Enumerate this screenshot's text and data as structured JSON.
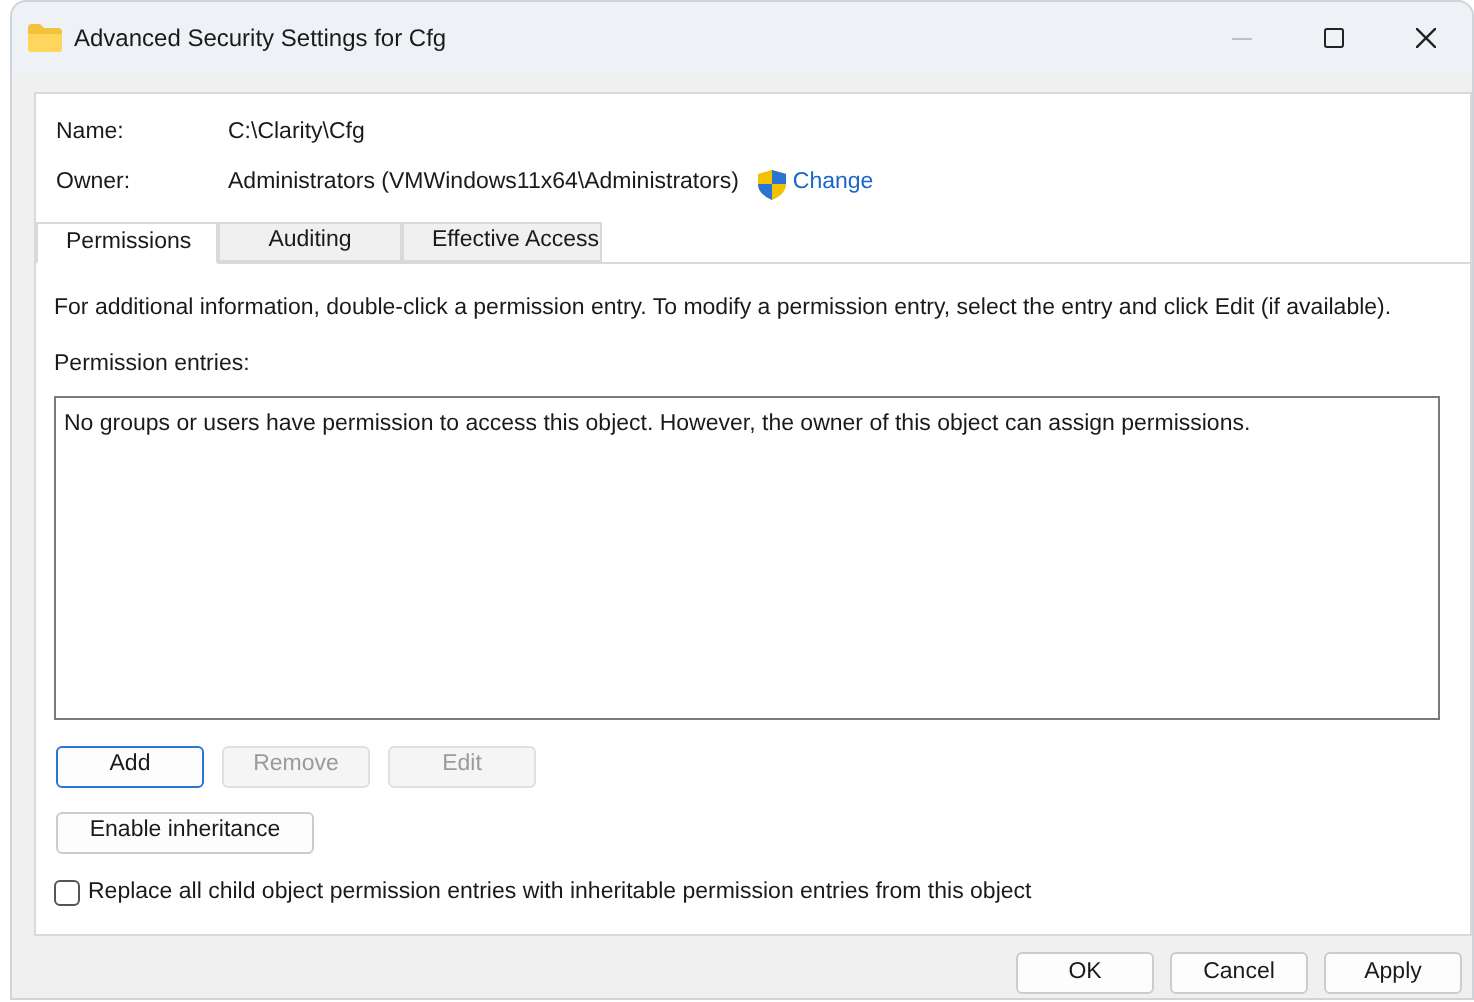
{
  "window": {
    "title": "Advanced Security Settings for Cfg",
    "minimize_disabled": true
  },
  "fields": [
    {
      "label": "Name:",
      "value": "C:\\Clarity\\Cfg"
    },
    {
      "label": "Owner:",
      "value": "Administrators (VMWindows11x64\\Administrators)",
      "link": "Change"
    }
  ],
  "tabs": [
    {
      "label": "Permissions",
      "selected": true
    },
    {
      "label": "Auditing",
      "selected": false
    },
    {
      "label": "Effective Access",
      "selected": false
    }
  ],
  "info": "For additional information, double-click a permission entry. To modify a permission entry, select the entry and click Edit (if available).",
  "entries_label": "Permission entries:",
  "entries_message": "No groups or users have permission to access this object. However, the owner of this object can assign permissions.",
  "entry_buttons": [
    {
      "label": "Add",
      "disabled": false,
      "default": true
    },
    {
      "label": "Remove",
      "disabled": true,
      "default": false
    },
    {
      "label": "Edit",
      "disabled": true,
      "default": false
    }
  ],
  "inheritance_button": "Enable inheritance",
  "replace_checkbox": {
    "label": "Replace all child object permission entries with inheritable permission entries from this object",
    "checked": false
  },
  "dialog_buttons": [
    "OK",
    "Cancel",
    "Apply"
  ]
}
